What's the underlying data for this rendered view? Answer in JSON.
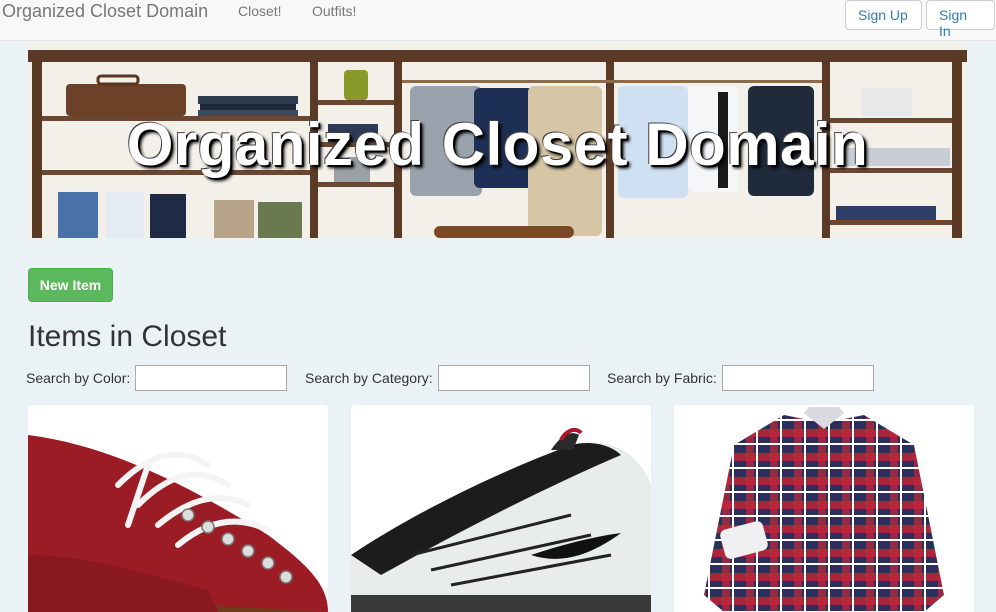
{
  "navbar": {
    "brand": "Organized Closet Domain",
    "links": [
      "Closet!",
      "Outfits!"
    ],
    "signup_label": "Sign Up",
    "signin_label": "Sign In"
  },
  "hero": {
    "title": "Organized Closet Domain"
  },
  "actions": {
    "new_item_label": "New Item"
  },
  "closet": {
    "heading": "Items in Closet",
    "search": {
      "color_label": "Search by Color:",
      "category_label": "Search by Category:",
      "fabric_label": "Search by Fabric:",
      "color_value": "",
      "category_value": "",
      "fabric_value": ""
    },
    "items": [
      {
        "name": "red-leather-shoe",
        "color": "#9b1c24"
      },
      {
        "name": "white-black-sneaker",
        "color": "#eceeec"
      },
      {
        "name": "plaid-shirt",
        "color": "#b0233a"
      }
    ]
  },
  "colors": {
    "accent": "#337ab7",
    "success": "#5cb85c",
    "page_bg": "#ebf2f6"
  }
}
